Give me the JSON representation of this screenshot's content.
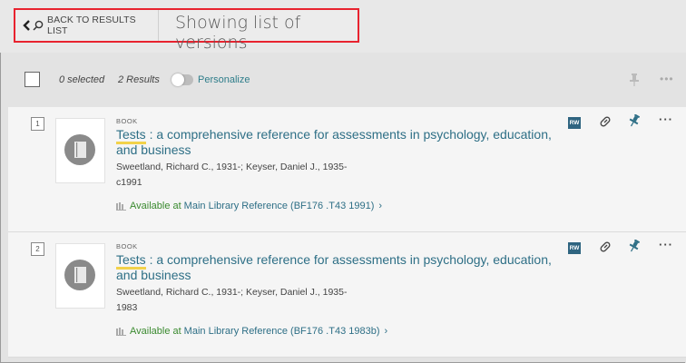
{
  "topbar": {
    "back_label": "BACK TO RESULTS LIST",
    "title": "Showing list of versions"
  },
  "controls": {
    "selected": "0 selected",
    "results": "2 Results",
    "personalize": "Personalize"
  },
  "results": [
    {
      "index": "1",
      "type": "BOOK",
      "title_first": "Tests",
      "title_rest": " : a comprehensive reference for assessments in psychology, education, and business",
      "author": "Sweetland, Richard C., 1931-; Keyser, Daniel J., 1935-",
      "date": "c1991",
      "availability_status": "Available at",
      "availability_location": "Main Library  Reference (BF176 .T43 1991)",
      "badge": "RW"
    },
    {
      "index": "2",
      "type": "BOOK",
      "title_first": "Tests",
      "title_rest": " : a comprehensive reference for assessments in psychology, education, and business",
      "author": "Sweetland, Richard C., 1931-; Keyser, Daniel J., 1935-",
      "date": "1983",
      "availability_status": "Available at",
      "availability_location": "Main Library  Reference (BF176 .T43 1983b)",
      "badge": "RW"
    }
  ],
  "colors": {
    "highlight_border": "#e8232f",
    "link": "#2e6f86",
    "available": "#3a8a2f",
    "title_underline": "#f2d24a"
  }
}
